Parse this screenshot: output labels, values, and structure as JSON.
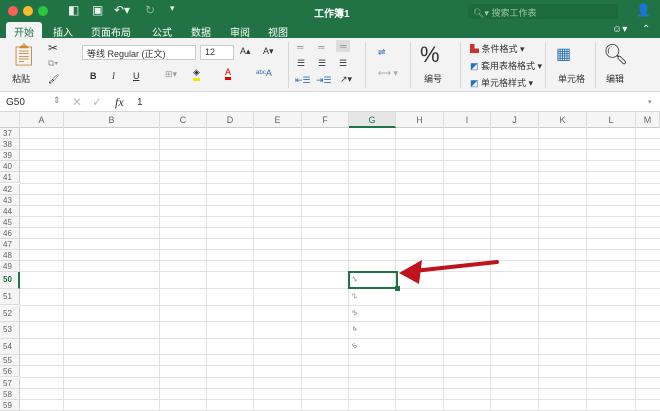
{
  "title_bar": {
    "workbook_title": "工作簿1",
    "search_placeholder": "搜索工作表"
  },
  "tabs": [
    "开始",
    "插入",
    "页面布局",
    "公式",
    "数据",
    "审阅",
    "视图"
  ],
  "ribbon": {
    "paste": "粘贴",
    "font_name": "等线 Regular (正文)",
    "font_size": "12",
    "bold": "B",
    "italic": "I",
    "underline": "U",
    "number_label": "编号",
    "percent": "%",
    "conditional_format": "条件格式",
    "table_format": "套用表格格式",
    "cell_style": "单元格样式",
    "cells_label": "单元格",
    "editing_label": "编辑"
  },
  "formula_bar": {
    "name_box": "G50",
    "fx": "fx",
    "value": "1"
  },
  "columns": [
    "A",
    "B",
    "C",
    "D",
    "E",
    "F",
    "G",
    "H",
    "I",
    "J",
    "K",
    "L",
    "M"
  ],
  "rows": [
    "37",
    "38",
    "39",
    "40",
    "41",
    "42",
    "43",
    "44",
    "45",
    "46",
    "47",
    "48",
    "49",
    "50",
    "51",
    "52",
    "53",
    "54",
    "55",
    "56",
    "57",
    "58",
    "59"
  ],
  "selected_cell": {
    "column": "G",
    "row": "50"
  },
  "cells_G": {
    "50": "1",
    "51": "2",
    "52": "3",
    "53": "4",
    "54": "5"
  },
  "colors": {
    "accent": "#217346",
    "arrow": "#c0141c"
  }
}
